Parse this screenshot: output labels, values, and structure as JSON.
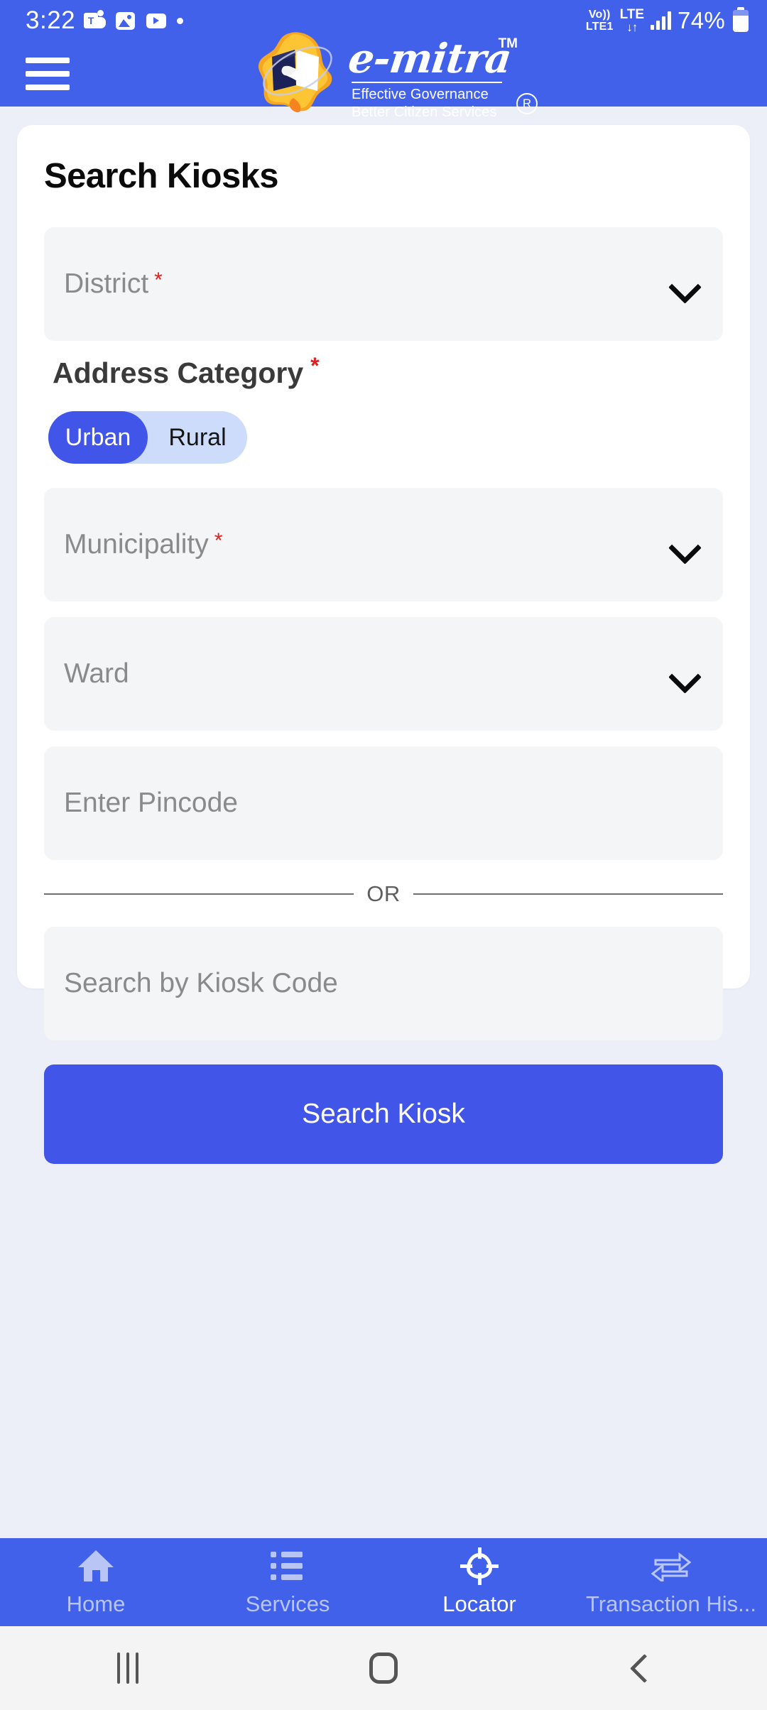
{
  "status_bar": {
    "time": "3:22",
    "left_icons": [
      "teams-icon",
      "image-icon",
      "youtube-icon",
      "dot-icon"
    ],
    "volte_top": "Vo))",
    "volte_bottom": "LTE1",
    "network_type": "LTE",
    "data_arrows": "↓↑",
    "signal_icon": "signal-bars-icon",
    "battery_percent": "74%",
    "battery_icon": "battery-icon"
  },
  "app_header": {
    "menu_icon": "hamburger-menu-icon",
    "logo_icon": "emitra-logo-icon",
    "brand_name": "e-mitra",
    "trademark": "TM",
    "tagline_line1": "Effective Governance",
    "tagline_line2": "Better Citizen Services",
    "registered_mark": "R"
  },
  "card": {
    "title": "Search Kiosks",
    "district": {
      "label": "District",
      "required": "*",
      "value": "",
      "placeholder": "District",
      "chevron_icon": "chevron-down-icon"
    },
    "address_category": {
      "label": "Address Category",
      "required": "*",
      "options": [
        "Urban",
        "Rural"
      ],
      "selected": "Urban"
    },
    "municipality": {
      "label": "Municipality",
      "required": "*",
      "value": "",
      "placeholder": "Municipality",
      "chevron_icon": "chevron-down-icon"
    },
    "ward": {
      "label": "Ward",
      "required": "",
      "value": "",
      "placeholder": "Ward",
      "chevron_icon": "chevron-down-icon"
    },
    "pincode": {
      "placeholder": "Enter Pincode",
      "value": ""
    },
    "divider_text": "OR",
    "kiosk_code": {
      "placeholder": "Search by Kiosk Code",
      "value": ""
    },
    "search_button": "Search Kiosk"
  },
  "bottom_nav": {
    "items": [
      {
        "label": "Home",
        "icon": "home-icon",
        "active": false
      },
      {
        "label": "Services",
        "icon": "list-icon",
        "active": false
      },
      {
        "label": "Locator",
        "icon": "locator-crosshair-icon",
        "active": true
      },
      {
        "label": "Transaction His...",
        "icon": "transaction-arrows-icon",
        "active": false
      }
    ]
  },
  "system_nav": {
    "recents": "recents-icon",
    "home": "home-square-icon",
    "back": "back-chevron-icon"
  },
  "colors": {
    "header_blue": "#4161EB",
    "accent_blue": "#4155E8",
    "toggle_track": "#CDDCFA",
    "page_bg": "#ECEEF8",
    "field_bg": "#F3F5F7",
    "required_red": "#E02020",
    "inactive_nav": "#B9C6F5"
  }
}
